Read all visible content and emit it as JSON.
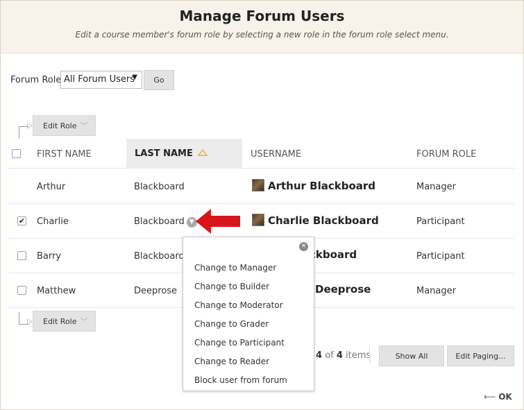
{
  "header": {
    "title": "Manage Forum Users",
    "subtitle": "Edit a course member's forum role by selecting a new role in the forum role select menu."
  },
  "filter": {
    "label": "Forum Role",
    "selected": "All Forum Users",
    "go_label": "Go"
  },
  "edit_role_label": "Edit Role",
  "columns": {
    "first_name": "FIRST NAME",
    "last_name": "LAST NAME",
    "username": "USERNAME",
    "forum_role": "FORUM ROLE"
  },
  "rows": [
    {
      "first": "Arthur",
      "last": "Blackboard",
      "username": "Arthur Blackboard",
      "role": "Manager",
      "checked": false
    },
    {
      "first": "Charlie",
      "last": "Blackboard",
      "username": "Charlie Blackboard",
      "role": "Participant",
      "checked": true
    },
    {
      "first": "Barry",
      "last": "Blackboard",
      "username": "ckboard",
      "role": "Participant",
      "checked": false
    },
    {
      "first": "Matthew",
      "last": "Deeprose",
      "username": "Deeprose",
      "role": "Manager",
      "checked": false
    }
  ],
  "role_menu": {
    "items": [
      "Change to Manager",
      "Change to Builder",
      "Change to Moderator",
      "Change to Grader",
      "Change to Participant",
      "Change to Reader",
      "Block user from forum"
    ]
  },
  "paging": {
    "prefix": "4",
    "of": "of",
    "total": "4",
    "suffix": "items",
    "show_all": "Show All",
    "edit_paging": "Edit Paging..."
  },
  "ok_label": "OK",
  "colors": {
    "header_bg": "#f7f3ea",
    "arrow_red": "#d9141b",
    "sort_triangle": "#e0b040"
  }
}
